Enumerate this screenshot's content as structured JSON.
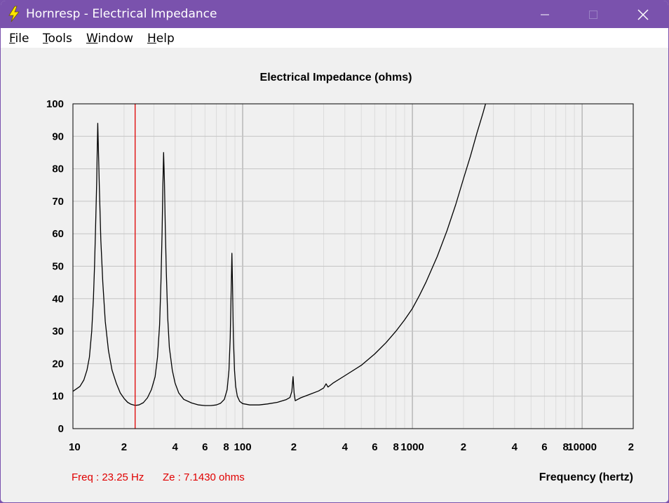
{
  "window": {
    "title": "Hornresp - Electrical Impedance",
    "controls": {
      "minimize": "minimize-icon",
      "maximize": "maximize-icon",
      "close": "close-icon"
    }
  },
  "menu": {
    "items": [
      {
        "label": "File",
        "accel": "F",
        "rest": "ile"
      },
      {
        "label": "Tools",
        "accel": "T",
        "rest": "ools"
      },
      {
        "label": "Window",
        "accel": "W",
        "rest": "indow"
      },
      {
        "label": "Help",
        "accel": "H",
        "rest": "elp"
      }
    ]
  },
  "readout": {
    "freq": "Freq : 23.25 Hz",
    "ze": "Ze : 7.1430 ohms"
  },
  "colors": {
    "titlebar": "#7a52ad",
    "curve": "#000000",
    "cursor": "#e00000",
    "grid": "#c8c8c8"
  },
  "chart_data": {
    "type": "line",
    "title": "Electrical Impedance (ohms)",
    "xlabel": "Frequency (hertz)",
    "ylabel": "",
    "x_scale": "log",
    "xlim": [
      10,
      20000
    ],
    "ylim": [
      0,
      100
    ],
    "grid": true,
    "y_ticks": [
      0,
      10,
      20,
      30,
      40,
      50,
      60,
      70,
      80,
      90,
      100
    ],
    "y_tick_labels": [
      "0",
      "10",
      "20",
      "30",
      "40",
      "50",
      "60",
      "70",
      "80",
      "90",
      "100"
    ],
    "x_ticks": [
      10,
      20,
      40,
      60,
      80,
      100,
      200,
      400,
      600,
      800,
      1000,
      2000,
      4000,
      6000,
      8000,
      10000,
      20000
    ],
    "x_tick_labels": [
      "10",
      "2",
      "4",
      "6",
      "8",
      "100",
      "2",
      "4",
      "6",
      "8",
      "1000",
      "2",
      "4",
      "6",
      "8",
      "10000",
      "2"
    ],
    "cursor": {
      "x": 23.25,
      "y": 7.143
    },
    "series": [
      {
        "values_xy": [
          [
            10,
            11.5
          ],
          [
            11,
            13
          ],
          [
            11.6,
            15
          ],
          [
            12.1,
            18
          ],
          [
            12.5,
            22
          ],
          [
            12.9,
            30
          ],
          [
            13.2,
            40
          ],
          [
            13.4,
            50
          ],
          [
            13.6,
            62
          ],
          [
            13.8,
            76
          ],
          [
            13.9,
            85
          ],
          [
            14.0,
            94
          ],
          [
            14.1,
            88
          ],
          [
            14.3,
            75
          ],
          [
            14.6,
            58
          ],
          [
            15.0,
            45
          ],
          [
            15.5,
            33
          ],
          [
            16.2,
            24
          ],
          [
            17,
            18
          ],
          [
            18,
            14
          ],
          [
            19,
            11
          ],
          [
            20,
            9.3
          ],
          [
            21,
            8.1
          ],
          [
            22,
            7.5
          ],
          [
            23.25,
            7.14
          ],
          [
            24.5,
            7.3
          ],
          [
            26,
            8
          ],
          [
            27.5,
            9.5
          ],
          [
            29,
            12
          ],
          [
            30.5,
            16
          ],
          [
            31.5,
            22
          ],
          [
            32.4,
            32
          ],
          [
            33.0,
            45
          ],
          [
            33.5,
            60
          ],
          [
            33.9,
            75
          ],
          [
            34.2,
            85
          ],
          [
            34.6,
            76
          ],
          [
            35.0,
            62
          ],
          [
            35.5,
            48
          ],
          [
            36.2,
            34
          ],
          [
            37,
            25
          ],
          [
            38.5,
            18
          ],
          [
            40,
            14
          ],
          [
            42,
            11
          ],
          [
            45,
            9
          ],
          [
            50,
            7.9
          ],
          [
            55,
            7.3
          ],
          [
            60,
            7.1
          ],
          [
            65,
            7.1
          ],
          [
            70,
            7.3
          ],
          [
            74,
            7.8
          ],
          [
            78,
            9
          ],
          [
            81,
            12
          ],
          [
            83,
            18
          ],
          [
            84.5,
            28
          ],
          [
            85.5,
            42
          ],
          [
            86.4,
            54
          ],
          [
            87.2,
            44
          ],
          [
            88.2,
            28
          ],
          [
            89.5,
            18
          ],
          [
            91,
            13
          ],
          [
            93,
            10
          ],
          [
            96,
            8.4
          ],
          [
            100,
            7.7
          ],
          [
            110,
            7.3
          ],
          [
            125,
            7.3
          ],
          [
            140,
            7.6
          ],
          [
            160,
            8.1
          ],
          [
            180,
            8.9
          ],
          [
            190,
            9.6
          ],
          [
            195,
            11.5
          ],
          [
            198,
            16
          ],
          [
            201,
            11
          ],
          [
            204,
            8.6
          ],
          [
            220,
            9.5
          ],
          [
            250,
            10.6
          ],
          [
            280,
            11.6
          ],
          [
            300,
            12.5
          ],
          [
            310,
            13.8
          ],
          [
            318,
            12.8
          ],
          [
            340,
            14
          ],
          [
            400,
            16.3
          ],
          [
            500,
            19.5
          ],
          [
            600,
            23
          ],
          [
            700,
            26.5
          ],
          [
            800,
            30
          ],
          [
            900,
            33.5
          ],
          [
            1000,
            37
          ],
          [
            1100,
            41
          ],
          [
            1200,
            45
          ],
          [
            1400,
            53
          ],
          [
            1600,
            61
          ],
          [
            1800,
            69
          ],
          [
            2000,
            77
          ],
          [
            2200,
            84
          ],
          [
            2400,
            91
          ],
          [
            2600,
            97
          ],
          [
            2800,
            103
          ]
        ]
      }
    ]
  }
}
